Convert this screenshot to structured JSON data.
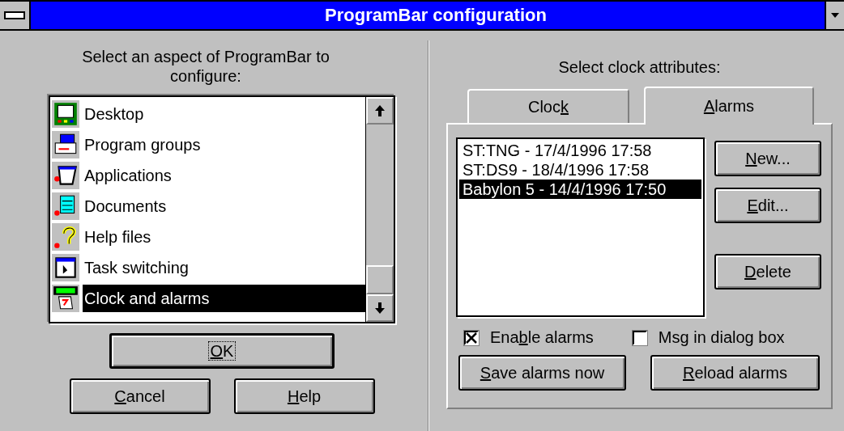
{
  "window": {
    "title": "ProgramBar configuration"
  },
  "left": {
    "prompt": "Select an aspect of ProgramBar to configure:",
    "items": [
      {
        "label": "Desktop",
        "selected": false
      },
      {
        "label": "Program groups",
        "selected": false
      },
      {
        "label": "Applications",
        "selected": false
      },
      {
        "label": "Documents",
        "selected": false
      },
      {
        "label": "Help files",
        "selected": false
      },
      {
        "label": "Task switching",
        "selected": false
      },
      {
        "label": "Clock and alarms",
        "selected": true
      }
    ],
    "buttons": [
      {
        "key": "O",
        "post": "K",
        "default": true
      },
      {
        "key": "C",
        "post": "ancel",
        "default": false
      },
      {
        "key": "H",
        "post": "elp",
        "default": false
      }
    ]
  },
  "right": {
    "prompt": "Select clock attributes:",
    "tabs": [
      {
        "pre": "Cloc",
        "key": "k",
        "selected": false
      },
      {
        "key": "A",
        "post": "larms",
        "selected": true
      }
    ],
    "alarms": [
      {
        "label": "ST:TNG - 17/4/1996 17:58",
        "selected": false
      },
      {
        "label": "ST:DS9 - 18/4/1996 17:58",
        "selected": false
      },
      {
        "label": "Babylon 5 - 14/4/1996 17:50",
        "selected": true
      }
    ],
    "side_buttons": [
      {
        "key": "N",
        "post": "ew..."
      },
      {
        "key": "E",
        "post": "dit..."
      },
      {
        "key": "D",
        "post": "elete"
      }
    ],
    "checkboxes": [
      {
        "pre": "Ena",
        "key": "b",
        "post": "le alarms",
        "checked": true
      },
      {
        "pre": "Msg in dialog box",
        "checked": false
      }
    ],
    "bottom_buttons": [
      {
        "key": "S",
        "post": "ave alarms now"
      },
      {
        "key": "R",
        "post": "eload alarms"
      }
    ]
  }
}
